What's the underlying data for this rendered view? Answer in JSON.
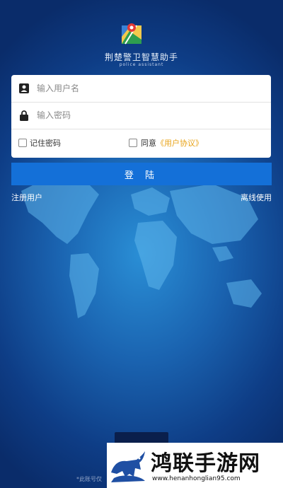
{
  "app": {
    "title": "荆楚警卫智慧助手",
    "subtitle": "police assistant"
  },
  "login_form": {
    "username_placeholder": "输入用户名",
    "password_placeholder": "输入密码",
    "remember_label": "记住密码",
    "agree_prefix": "同意",
    "agreement_link": "《用户协议》"
  },
  "actions": {
    "login_label": "登 陆",
    "register_label": "注册用户",
    "offline_label": "离线使用"
  },
  "footer": {
    "note": "*此账号仅"
  },
  "watermark": {
    "title": "鸿联手游网",
    "url": "www.henanhonglian95.com"
  },
  "colors": {
    "primary": "#1470d8",
    "agreement_link": "#e8a317",
    "background_center": "#2a8fd6",
    "background_edge": "#0a2c6a"
  },
  "icons": {
    "logo": "map-pin-icon",
    "username": "user-icon",
    "password": "lock-icon"
  }
}
